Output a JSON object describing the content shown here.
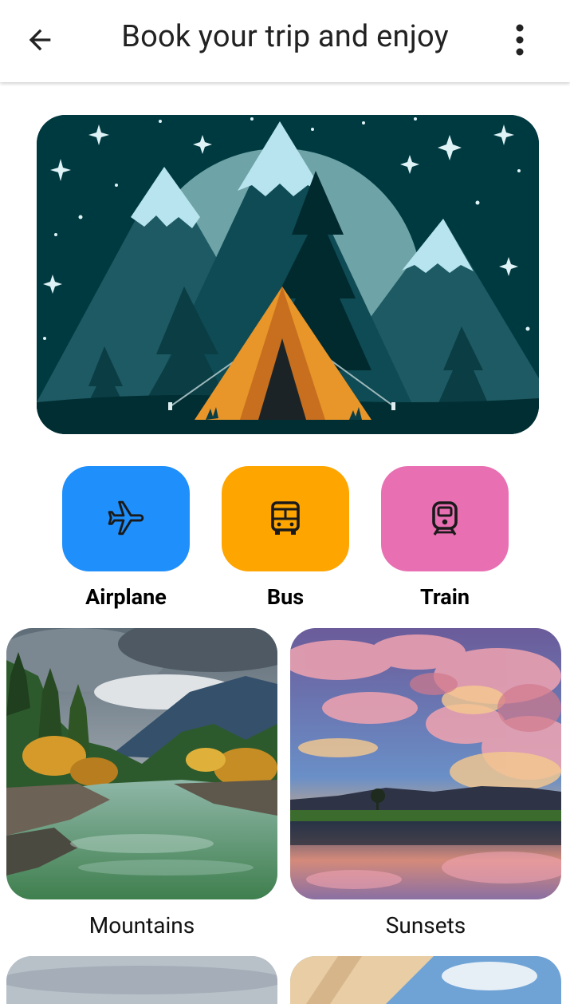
{
  "appbar": {
    "title": "Book your trip and enjoy"
  },
  "transport": [
    {
      "label": "Airplane",
      "color": "#1f8ffb"
    },
    {
      "label": "Bus",
      "color": "#ffa500"
    },
    {
      "label": "Train",
      "color": "#e86fb2"
    }
  ],
  "destinations": [
    {
      "label": "Mountains"
    },
    {
      "label": "Sunsets"
    }
  ]
}
